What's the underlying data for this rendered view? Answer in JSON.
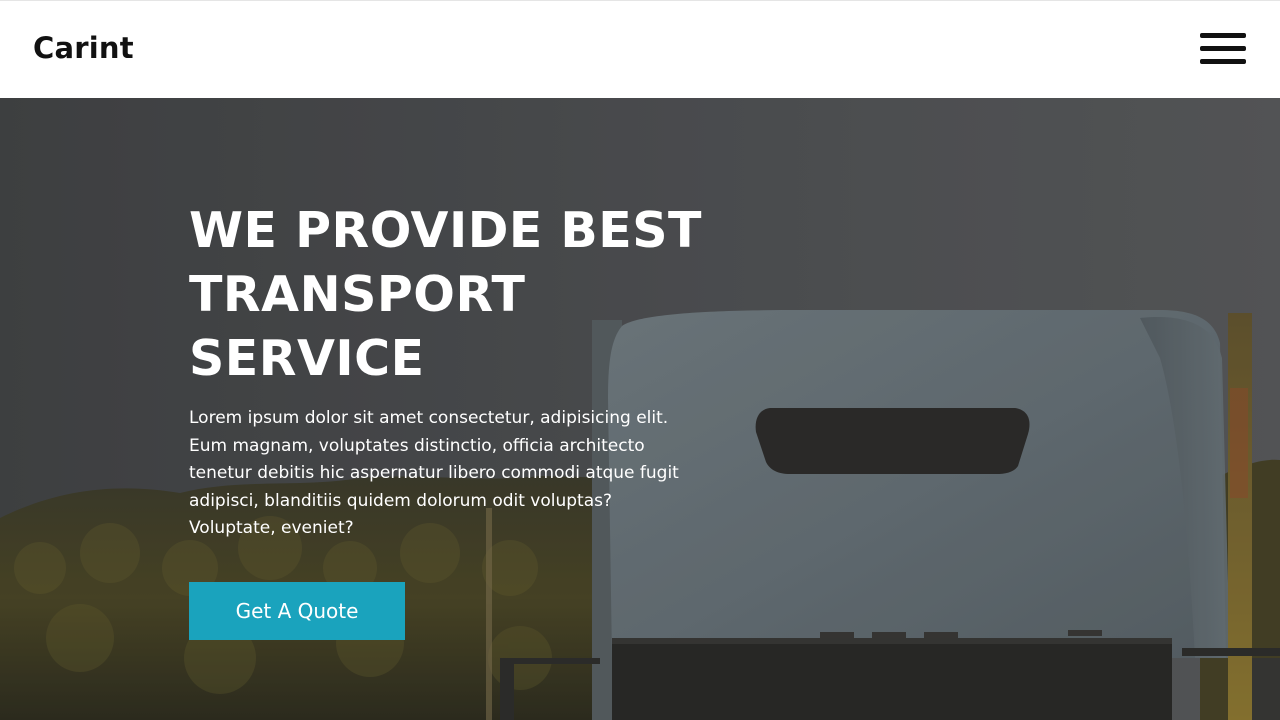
{
  "header": {
    "brand": "Carint",
    "menu_icon": "hamburger-menu-icon"
  },
  "hero": {
    "title": "WE PROVIDE BEST TRANSPORT SERVICE",
    "text": "Lorem ipsum dolor sit amet consectetur, adipisicing elit. Eum magnam, voluptates distinctio, officia architecto tenetur debitis hic aspernatur libero commodi atque fugit adipisci, blanditiis quidem dolorum odit voluptas? Voluptate, eveniet?",
    "cta_label": "Get A Quote",
    "background": "truck-photo"
  },
  "colors": {
    "accent": "#1aa3bd",
    "header_bg": "#ffffff",
    "brand_text": "#111111"
  }
}
